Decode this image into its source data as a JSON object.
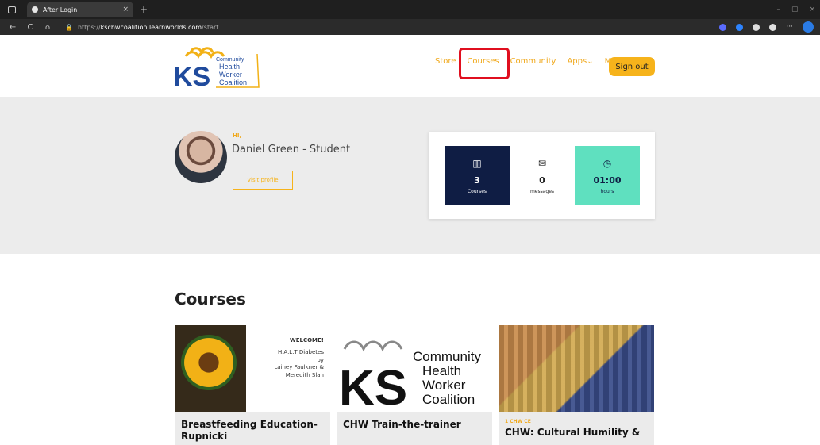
{
  "browser": {
    "tab_title": "After Login",
    "tab_close": "×",
    "new_tab": "+",
    "window_controls": [
      "–",
      "▢",
      "×"
    ],
    "url_prefix": "https://",
    "url_host": "kschwcoalition.learnworlds.com",
    "url_path": "/start",
    "extensions_more": "···",
    "nav_back": "←",
    "nav_reload": "C",
    "nav_home": "⌂"
  },
  "site": {
    "logo_letters": "KS",
    "logo_lines": [
      "Community",
      "Health",
      "Worker",
      "Coalition"
    ],
    "nav": [
      "Store",
      "Courses",
      "Community",
      "Apps",
      "Me"
    ],
    "nav_dropdown_marker": "⌄",
    "signout": "Sign out"
  },
  "hero": {
    "greeting": "HI,",
    "name": "Daniel Green - Student",
    "visit_profile": "Visit profile",
    "stats": [
      {
        "value": "3",
        "label": "Courses",
        "icon": "book-icon"
      },
      {
        "value": "0",
        "label": "messages",
        "icon": "mail-icon"
      },
      {
        "value": "01:00",
        "label": "hours",
        "icon": "clock-icon"
      }
    ]
  },
  "courses": {
    "heading": "Courses",
    "cards": [
      {
        "title": "Breastfeeding Education-Rupnicki",
        "ce": "",
        "thumb_lines": [
          "WELCOME!",
          "H.A.L.T Diabetes",
          "by",
          "Lainey Faulkner &",
          "Meredith Slan"
        ]
      },
      {
        "title": "CHW Train-the-trainer",
        "ce": ""
      },
      {
        "title": "CHW: Cultural Humility &",
        "ce": "1 CHW CE"
      }
    ]
  },
  "colors": {
    "accent": "#f0a81a",
    "navy": "#0f1d44",
    "mint": "#5fe0bf",
    "highlight": "#e00f1f"
  }
}
